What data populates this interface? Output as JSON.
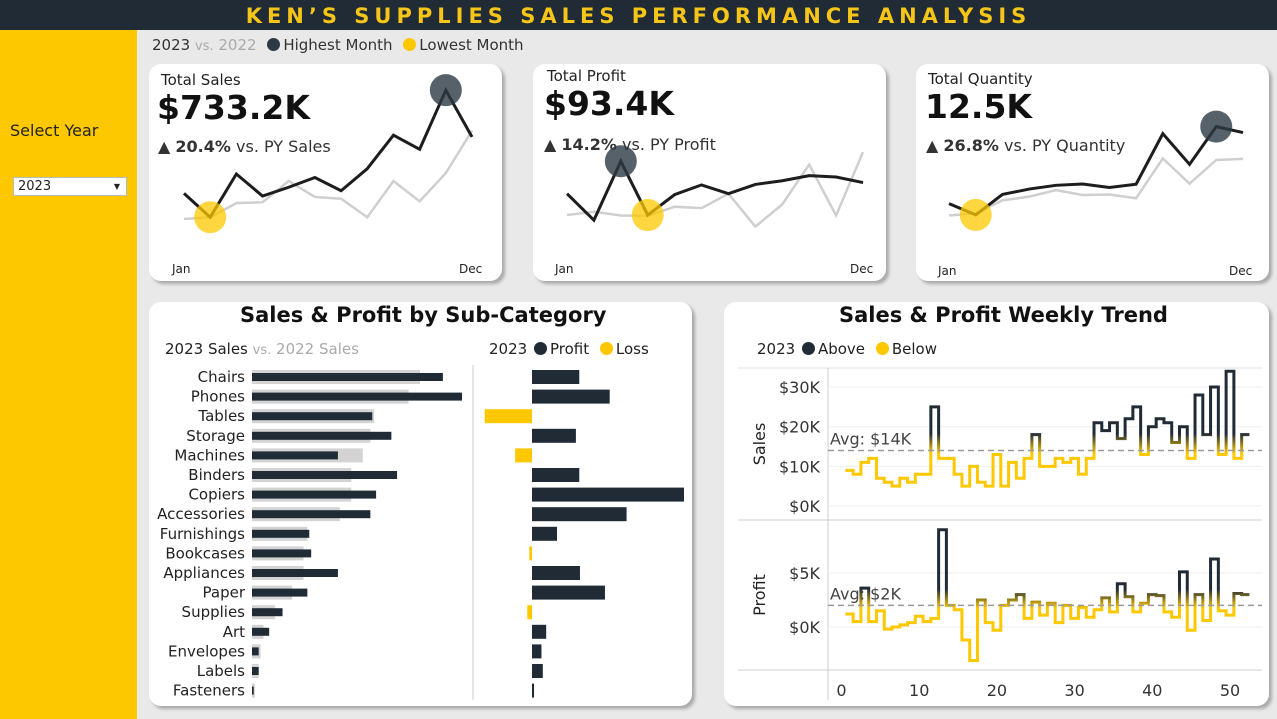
{
  "header": {
    "title": "KEN’S SUPPLIES SALES PERFORMANCE ANALYSIS"
  },
  "sidebar": {
    "label": "Select Year",
    "year_value": "2023"
  },
  "legend": {
    "year": "2023",
    "vs": "vs.",
    "py": "2022",
    "highest": "Highest Month",
    "lowest": "Lowest Month"
  },
  "colors": {
    "dark": "#202b36",
    "yellow": "#fdc800",
    "grey_line": "#cfcfcf"
  },
  "kpis": [
    {
      "title": "Total Sales",
      "value": "$733.2K",
      "delta_pct": "20.4%",
      "delta_text": "vs. PY Sales",
      "start": "Jan",
      "end": "Dec"
    },
    {
      "title": "Total Profit",
      "value": "$93.4K",
      "delta_pct": "14.2%",
      "delta_text": "vs. PY Profit",
      "start": "Jan",
      "end": "Dec"
    },
    {
      "title": "Total Quantity",
      "value": "12.5K",
      "delta_pct": "26.8%",
      "delta_text": "vs. PY Quantity",
      "start": "Jan",
      "end": "Dec"
    }
  ],
  "subcat": {
    "title": "Sales & Profit by Sub-Category",
    "sales_legend": {
      "cur": "2023 Sales",
      "vs": "vs.",
      "py": "2022 Sales"
    },
    "profit_legend": {
      "year": "2023",
      "profit": "Profit",
      "loss": "Loss"
    }
  },
  "weekly": {
    "title": "Sales & Profit Weekly Trend",
    "legend": {
      "year": "2023",
      "above": "Above",
      "below": "Below"
    },
    "sales_axis": "Sales",
    "profit_axis": "Profit",
    "sales_avg_label": "Avg: $14K",
    "profit_avg_label": "Avg: $2K"
  },
  "chart_data": [
    {
      "type": "line",
      "title": "Total Sales",
      "x": [
        1,
        2,
        3,
        4,
        5,
        6,
        7,
        8,
        9,
        10,
        11,
        12
      ],
      "series": [
        {
          "name": "2023",
          "values": [
            46,
            19,
            68,
            43,
            53,
            64,
            49,
            74,
            112,
            96,
            163,
            110
          ]
        },
        {
          "name": "2022",
          "values": [
            17,
            19,
            35,
            36,
            60,
            42,
            40,
            19,
            60,
            37,
            69,
            117
          ]
        }
      ],
      "ylim": [
        0,
        170
      ],
      "highest_index": 10,
      "lowest_index": 1
    },
    {
      "type": "line",
      "title": "Total Profit",
      "x": [
        1,
        2,
        3,
        4,
        5,
        6,
        7,
        8,
        9,
        10,
        11,
        12
      ],
      "series": [
        {
          "name": "2023",
          "values": [
            6.2,
            0.5,
            13.2,
            1.6,
            6.0,
            8.1,
            6.2,
            8.2,
            9.0,
            10.1,
            9.8,
            8.6
          ]
        },
        {
          "name": "2022",
          "values": [
            1.6,
            2.3,
            1.5,
            1.4,
            3.4,
            3.1,
            6.2,
            -0.9,
            3.9,
            12.5,
            1.5,
            15.2
          ]
        }
      ],
      "ylim": [
        -4,
        18
      ],
      "highest_index": 2,
      "lowest_index": 3
    },
    {
      "type": "line",
      "title": "Total Quantity",
      "x": [
        1,
        2,
        3,
        4,
        5,
        6,
        7,
        8,
        9,
        10,
        11,
        12
      ],
      "series": [
        {
          "name": "2023",
          "values": [
            750,
            540,
            920,
            1020,
            1090,
            1115,
            1050,
            1110,
            2050,
            1480,
            2180,
            2070
          ]
        },
        {
          "name": "2022",
          "values": [
            530,
            570,
            810,
            880,
            1000,
            910,
            920,
            850,
            1590,
            1120,
            1560,
            1580
          ]
        }
      ],
      "ylim": [
        0,
        2600
      ],
      "highest_index": 10,
      "lowest_index": 1
    },
    {
      "type": "bar",
      "title": "Sales & Profit by Sub-Category",
      "categories": [
        "Chairs",
        "Phones",
        "Tables",
        "Storage",
        "Machines",
        "Binders",
        "Copiers",
        "Accessories",
        "Furnishings",
        "Bookcases",
        "Appliances",
        "Paper",
        "Supplies",
        "Art",
        "Envelopes",
        "Labels",
        "Fasteners"
      ],
      "series": [
        {
          "name": "2023 Sales",
          "values": [
            100,
            110,
            63,
            73,
            45,
            76,
            65,
            62,
            30,
            31,
            45,
            29,
            16,
            9,
            3.5,
            3.5,
            0.9
          ]
        },
        {
          "name": "2022 Sales",
          "values": [
            88,
            82,
            64,
            62,
            58,
            52,
            52,
            46,
            29,
            27,
            27,
            21,
            12,
            6,
            4.5,
            3.5,
            1.5
          ]
        },
        {
          "name": "Profit",
          "values": [
            7.0,
            11.5,
            -7.0,
            6.5,
            -2.5,
            7.0,
            22.5,
            14.0,
            3.7,
            -0.4,
            7.1,
            10.8,
            -0.7,
            2.1,
            1.4,
            1.6,
            0.3
          ]
        }
      ]
    },
    {
      "type": "line",
      "title": "Sales Weekly Trend",
      "x": [
        1,
        2,
        3,
        4,
        5,
        6,
        7,
        8,
        9,
        10,
        11,
        12,
        13,
        14,
        15,
        16,
        17,
        18,
        19,
        20,
        21,
        22,
        23,
        24,
        25,
        26,
        27,
        28,
        29,
        30,
        31,
        32,
        33,
        34,
        35,
        36,
        37,
        38,
        39,
        40,
        41,
        42,
        43,
        44,
        45,
        46,
        47,
        48,
        49,
        50,
        51,
        52
      ],
      "series": [
        {
          "name": "2023",
          "values": [
            9,
            8,
            11,
            12,
            7,
            6,
            5,
            7,
            6,
            8,
            8,
            25,
            12,
            12,
            8,
            5,
            10,
            6,
            5,
            13,
            5,
            11,
            7,
            12,
            18,
            10,
            10,
            12,
            11,
            12,
            8,
            12,
            21,
            19,
            21,
            17,
            22,
            25,
            13,
            20,
            22,
            21,
            16,
            20,
            12,
            28,
            18,
            30,
            13,
            34,
            12,
            18
          ]
        }
      ],
      "xlabel": "",
      "ylabel": "Sales",
      "avg": 14,
      "ylim": [
        0,
        34
      ]
    },
    {
      "type": "line",
      "title": "Profit Weekly Trend",
      "x": [
        1,
        2,
        3,
        4,
        5,
        6,
        7,
        8,
        9,
        10,
        11,
        12,
        13,
        14,
        15,
        16,
        17,
        18,
        19,
        20,
        21,
        22,
        23,
        24,
        25,
        26,
        27,
        28,
        29,
        30,
        31,
        32,
        33,
        34,
        35,
        36,
        37,
        38,
        39,
        40,
        41,
        42,
        43,
        44,
        45,
        46,
        47,
        48,
        49,
        50,
        51,
        52
      ],
      "series": [
        {
          "name": "2023",
          "values": [
            1.2,
            0.5,
            3.6,
            0.5,
            1.5,
            -0.2,
            0,
            0.2,
            0.4,
            1,
            0.5,
            0.8,
            9,
            2,
            1.6,
            -1.2,
            -3.1,
            2.5,
            0.4,
            -0.3,
            2,
            2.5,
            3,
            0.8,
            2.3,
            1.1,
            2.2,
            0.4,
            2,
            0.8,
            1.8,
            0.9,
            1.6,
            2.7,
            1.4,
            4,
            2.8,
            1.4,
            2.2,
            3,
            2.9,
            1.4,
            0.9,
            5.1,
            -0.3,
            3,
            0.6,
            6.3,
            1.5,
            1.1,
            3.1,
            3
          ]
        }
      ],
      "xlabel": "",
      "ylabel": "Profit",
      "avg": 2,
      "ylim": [
        -4,
        10
      ],
      "x_ticks": [
        "0",
        "10",
        "20",
        "30",
        "40",
        "50"
      ]
    }
  ]
}
